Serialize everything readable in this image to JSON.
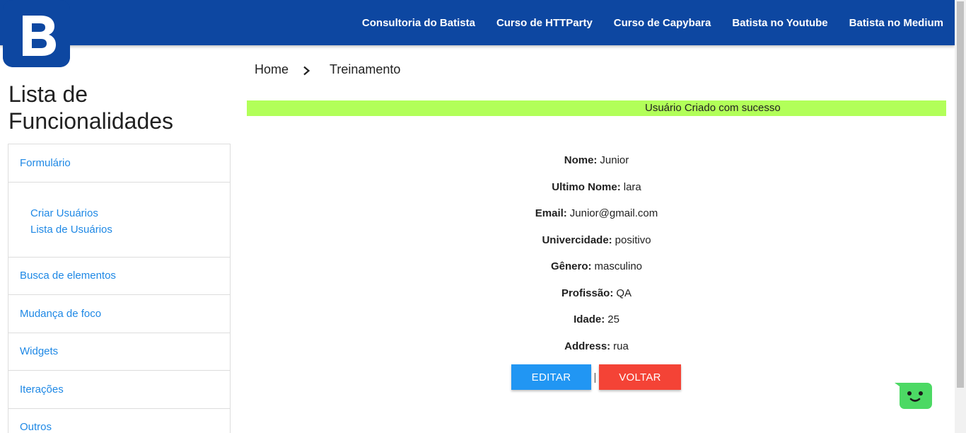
{
  "logo": {
    "letter": "B",
    "color": "#0d47a1"
  },
  "nav": {
    "links": [
      "Consultoria do Batista",
      "Curso de HTTParty",
      "Curso de Capybara",
      "Batista no Youtube",
      "Batista no Medium"
    ]
  },
  "sidebar": {
    "title": "Lista de Funcionalidades",
    "items": [
      "Formulário",
      "Busca de elementos",
      "Mudança de foco",
      "Widgets",
      "Iterações",
      "Outros"
    ],
    "sub_items": [
      "Criar Usuários",
      "Lista de Usuários"
    ]
  },
  "breadcrumb": {
    "home": "Home",
    "current": "Treinamento",
    "separator_icon": "chevron-right-icon"
  },
  "flash": {
    "message": "Usuário Criado com sucesso",
    "color": "#b2ff59"
  },
  "details": [
    {
      "label": "Nome:",
      "value": "Junior"
    },
    {
      "label": "Ultimo Nome:",
      "value": "lara"
    },
    {
      "label": "Email:",
      "value": "Junior@gmail.com"
    },
    {
      "label": "Univercidade:",
      "value": "positivo"
    },
    {
      "label": "Gênero:",
      "value": "masculino"
    },
    {
      "label": "Profissão:",
      "value": "QA"
    },
    {
      "label": "Idade:",
      "value": "25"
    },
    {
      "label": "Address:",
      "value": "rua"
    }
  ],
  "actions": {
    "edit": "EDITAR",
    "separator": "|",
    "back": "VOLTAR",
    "edit_color": "#2196f3",
    "back_color": "#f44336"
  },
  "chat": {
    "icon": "chat-bot-icon",
    "color": "#4cd964"
  }
}
